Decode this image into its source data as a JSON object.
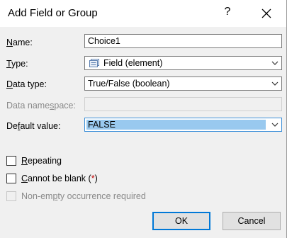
{
  "dialog": {
    "title": "Add Field or Group",
    "help_glyph": "?",
    "close_icon": "close-icon"
  },
  "form": {
    "name": {
      "label_u": "N",
      "label_rest": "ame:",
      "value": "Choice1"
    },
    "type": {
      "label_u": "T",
      "label_rest": "ype:",
      "value": "Field (element)",
      "icon": "field-element-icon"
    },
    "data_type": {
      "label_pre": "",
      "label_u": "D",
      "label_rest": "ata type:",
      "value": "True/False (boolean)"
    },
    "data_namespace": {
      "label_pre": "Data name",
      "label_u": "s",
      "label_rest": "pace:",
      "value": ""
    },
    "default_value": {
      "label_pre": "De",
      "label_u": "f",
      "label_rest": "ault value:",
      "value": "FALSE"
    }
  },
  "options": {
    "repeating": {
      "label_u": "R",
      "label_rest": "epeating",
      "checked": false,
      "enabled": true
    },
    "cannot_be_blank": {
      "label_u": "C",
      "label_rest": "annot be blank",
      "req_open": " (",
      "req_mark": "*",
      "req_close": ")",
      "checked": false,
      "enabled": true
    },
    "non_empty": {
      "label_pre": "Non-em",
      "label_u": "p",
      "label_rest": "ty occurrence required",
      "checked": false,
      "enabled": false
    }
  },
  "buttons": {
    "ok": "OK",
    "cancel": "Cancel"
  },
  "colors": {
    "selection": "#99c9ef",
    "focus_border": "#0078d7",
    "required": "#c00000"
  }
}
